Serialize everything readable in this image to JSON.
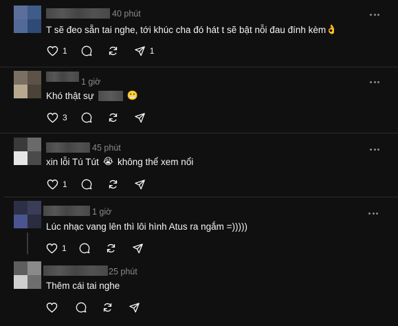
{
  "comments": [
    {
      "time": "40 phút",
      "text": "T sẽ đeo sẵn tai nghe, tới khúc cha đó hát t sẽ bật nỗi đau đính kèm",
      "emoji": "👌",
      "likes": "1",
      "reposts": "1",
      "avatar_colors": [
        "#5b6f9a",
        "#3f5c88",
        "#526a98",
        "#2f4a76"
      ]
    },
    {
      "time": "1 giờ",
      "text": "Khó thật sự",
      "emoji": "😬",
      "likes": "3",
      "reposts": "",
      "avatar_colors": [
        "#7a6f63",
        "#5c5248",
        "#b8a88e",
        "#4b4238"
      ]
    },
    {
      "time": "45 phút",
      "text_before": "xin lỗi Tú Tút",
      "emoji": "😭",
      "text_after": "không thể xem nổi",
      "likes": "1",
      "reposts": "",
      "avatar_colors": [
        "#3a3a3a",
        "#6a6a6a",
        "#e6e6e6",
        "#4a4a4a"
      ]
    },
    {
      "time": "1 giờ",
      "text": "Lúc nhạc vang lên thì lôi hình Atus ra ngắm =)))))",
      "likes": "1",
      "reposts": "",
      "avatar_colors": [
        "#2d2f46",
        "#3a3c58",
        "#4a5490",
        "#2a2c40"
      ]
    },
    {
      "time": "25 phút",
      "text": "Thêm cái tai nghe",
      "likes": "",
      "reposts": "",
      "avatar_colors": [
        "#5e5e5e",
        "#8a8a8a",
        "#cfcfcf",
        "#6e6e6e"
      ]
    }
  ],
  "icons": {
    "like": "heart-icon",
    "reply": "comment-icon",
    "repost": "repost-icon",
    "share": "send-icon",
    "more": "more-icon"
  },
  "colors": {
    "background": "#101010",
    "text": "#f3f5f7",
    "muted": "#8a8a8a",
    "divider": "#2c2c2c"
  }
}
